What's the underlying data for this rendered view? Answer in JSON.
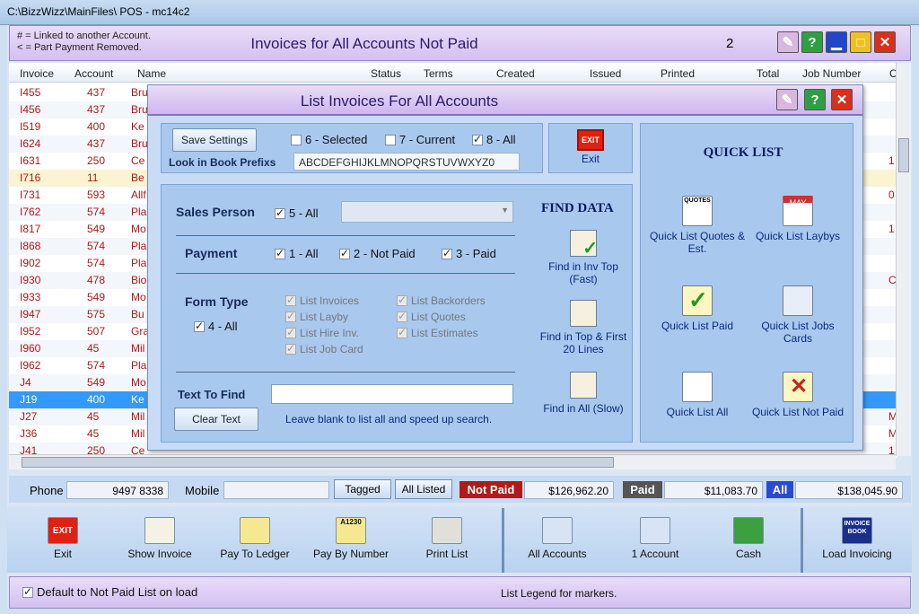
{
  "window": {
    "title": "C:\\BizzWizz\\MainFiles\\ POS - mc14c2"
  },
  "header": {
    "note1": "# = Linked to another Account.",
    "note2": "< = Part Payment Removed.",
    "title": "Invoices for All Accounts Not Paid",
    "count": "2"
  },
  "columns": [
    "Invoice",
    "Account",
    "Name",
    "Status",
    "Terms",
    "Created",
    "Issued",
    "Printed",
    "Total",
    "Job Number",
    "C"
  ],
  "rows": [
    {
      "invoice": "I455",
      "account": "437",
      "name": "Bru",
      "right": ""
    },
    {
      "invoice": "I456",
      "account": "437",
      "name": "Bru",
      "right": ""
    },
    {
      "invoice": "I519",
      "account": "400",
      "name": "Ke",
      "right": ""
    },
    {
      "invoice": "I624",
      "account": "437",
      "name": "Bru",
      "right": ""
    },
    {
      "invoice": "I631",
      "account": "250",
      "name": "Ce",
      "right": "1"
    },
    {
      "invoice": "I716",
      "account": "11",
      "name": "Be",
      "right": ""
    },
    {
      "invoice": "I731",
      "account": "593",
      "name": "Allf",
      "right": "0"
    },
    {
      "invoice": "I762",
      "account": "574",
      "name": "Pla",
      "right": ""
    },
    {
      "invoice": "I817",
      "account": "549",
      "name": "Mo",
      "right": "1"
    },
    {
      "invoice": "I868",
      "account": "574",
      "name": "Pla",
      "right": ""
    },
    {
      "invoice": "I902",
      "account": "574",
      "name": "Pla",
      "right": ""
    },
    {
      "invoice": "I930",
      "account": "478",
      "name": "Bio",
      "right": "C"
    },
    {
      "invoice": "I933",
      "account": "549",
      "name": "Mo",
      "right": ""
    },
    {
      "invoice": "I947",
      "account": "575",
      "name": "Bu",
      "right": ""
    },
    {
      "invoice": "I952",
      "account": "507",
      "name": "Gra",
      "right": ""
    },
    {
      "invoice": "I960",
      "account": "45",
      "name": "Mil",
      "right": ""
    },
    {
      "invoice": "I962",
      "account": "574",
      "name": "Pla",
      "right": ""
    },
    {
      "invoice": "J4",
      "account": "549",
      "name": "Mo",
      "right": ""
    },
    {
      "invoice": "J19",
      "account": "400",
      "name": "Ke",
      "right": ""
    },
    {
      "invoice": "J27",
      "account": "45",
      "name": "Mil",
      "right": "M"
    },
    {
      "invoice": "J36",
      "account": "45",
      "name": "Mil",
      "right": "M"
    },
    {
      "invoice": "J41",
      "account": "250",
      "name": "Ce",
      "right": "1"
    }
  ],
  "dialog": {
    "title": "List Invoices For All Accounts",
    "save_settings": "Save Settings",
    "opt_selected": "6 - Selected",
    "opt_current": "7 - Current",
    "opt_all": "8 - All",
    "look_in_label": "Look in Book Prefixs",
    "prefixes": "ABCDEFGHIJKLMNOPQRSTUVWXYZ0",
    "exit_label": "Exit",
    "exit_icon_text": "EXIT",
    "sales_person": "Sales Person",
    "sales_all": "5 - All",
    "payment": "Payment",
    "pay_all": "1 - All",
    "pay_notpaid": "2 - Not Paid",
    "pay_paid": "3 - Paid",
    "form_type": "Form Type",
    "form_all": "4 - All",
    "form_items": [
      "List Invoices",
      "List Layby",
      "List Hire Inv.",
      "List Job Card",
      "List Backorders",
      "List Quotes",
      "List Estimates"
    ],
    "text_to_find": "Text To Find",
    "clear_text": "Clear Text",
    "hint": "Leave blank to list all and speed up search.",
    "find_data": "FIND DATA",
    "find1": "Find in Inv Top (Fast)",
    "find2": "Find in Top & First 20 Lines",
    "find3": "Find in All (Slow)",
    "quick_list": "QUICK LIST",
    "q1": "Quick List Quotes & Est.",
    "q2": "Quick List Laybys",
    "q3": "Quick List Paid",
    "q4": "Quick List Jobs Cards",
    "q5": "Quick List All",
    "q6": "Quick List Not Paid",
    "q_quotes_icon_text": "QUOTES",
    "q_laybys_icon_text": "MAY"
  },
  "status": {
    "phone_label": "Phone",
    "phone": "9497 8338",
    "mobile_label": "Mobile",
    "mobile": "",
    "tagged": "Tagged",
    "all_listed": "All Listed",
    "not_paid_label": "Not Paid",
    "not_paid": "$126,962.20",
    "paid_label": "Paid",
    "paid": "$11,083.70",
    "all_label": "All",
    "all": "$138,045.90"
  },
  "toolbar": [
    "Exit",
    "Show Invoice",
    "Pay To Ledger",
    "Pay By Number",
    "Print List",
    "All Accounts",
    "1 Account",
    "Cash",
    "Load Invoicing"
  ],
  "toolbar_icon_text": {
    "exit": "EXIT",
    "pay_by_number": "A1230",
    "load_invoicing": "INVOICE BOOK"
  },
  "footer": {
    "default_label": "Default to Not Paid List on load",
    "legend": "List Legend for markers."
  },
  "colors": {
    "accent": "#2a1a6a",
    "invoice_red": "#b01818",
    "selected_row": "#3399ff"
  }
}
